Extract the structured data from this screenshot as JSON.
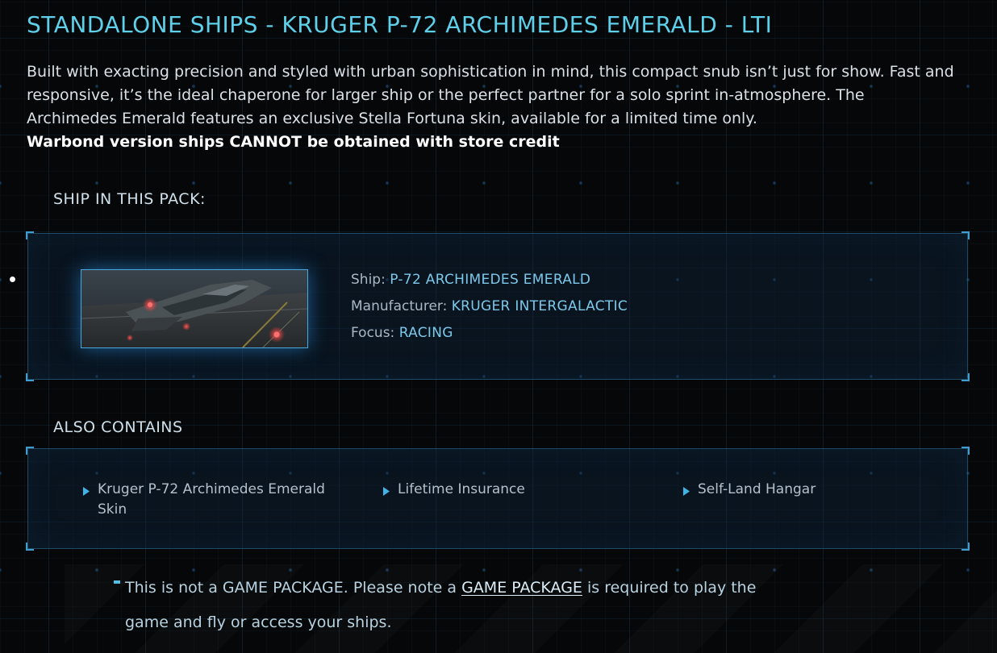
{
  "page": {
    "title": "STANDALONE SHIPS - KRUGER P-72 ARCHIMEDES EMERALD - LTI",
    "description": "Built with exacting precision and styled with urban sophistication in mind, this compact snub isn’t just for show. Fast and responsive, it’s the ideal chaperone for larger ship or the perfect partner for a solo sprint in-atmosphere. The Archimedes Emerald features an exclusive Stella Fortuna skin, available for a limited time only.",
    "warbond_note": "Warbond version ships CANNOT be obtained with store credit"
  },
  "ship_section": {
    "heading": "SHIP IN THIS PACK:",
    "ship": {
      "ship_label": "Ship: ",
      "ship_value": "P-72 ARCHIMEDES EMERALD",
      "manufacturer_label": "Manufacturer: ",
      "manufacturer_value": "KRUGER INTERGALACTIC",
      "focus_label": "Focus: ",
      "focus_value": "RACING"
    }
  },
  "contains_section": {
    "heading": "ALSO CONTAINS",
    "items": [
      {
        "label": "Kruger P-72 Archimedes Emerald Skin"
      },
      {
        "label": "Lifetime Insurance"
      },
      {
        "label": "Self-Land Hangar"
      }
    ]
  },
  "footer": {
    "text_before": "This is not a GAME PACKAGE. Please note a ",
    "link_text": "GAME PACKAGE",
    "text_after": " is required to play the game and fly or access your ships."
  },
  "colors": {
    "accent": "#5fd0ea",
    "value_text": "#7cc8ea",
    "background": "#050709",
    "panel_border": "#3f9ecf"
  }
}
